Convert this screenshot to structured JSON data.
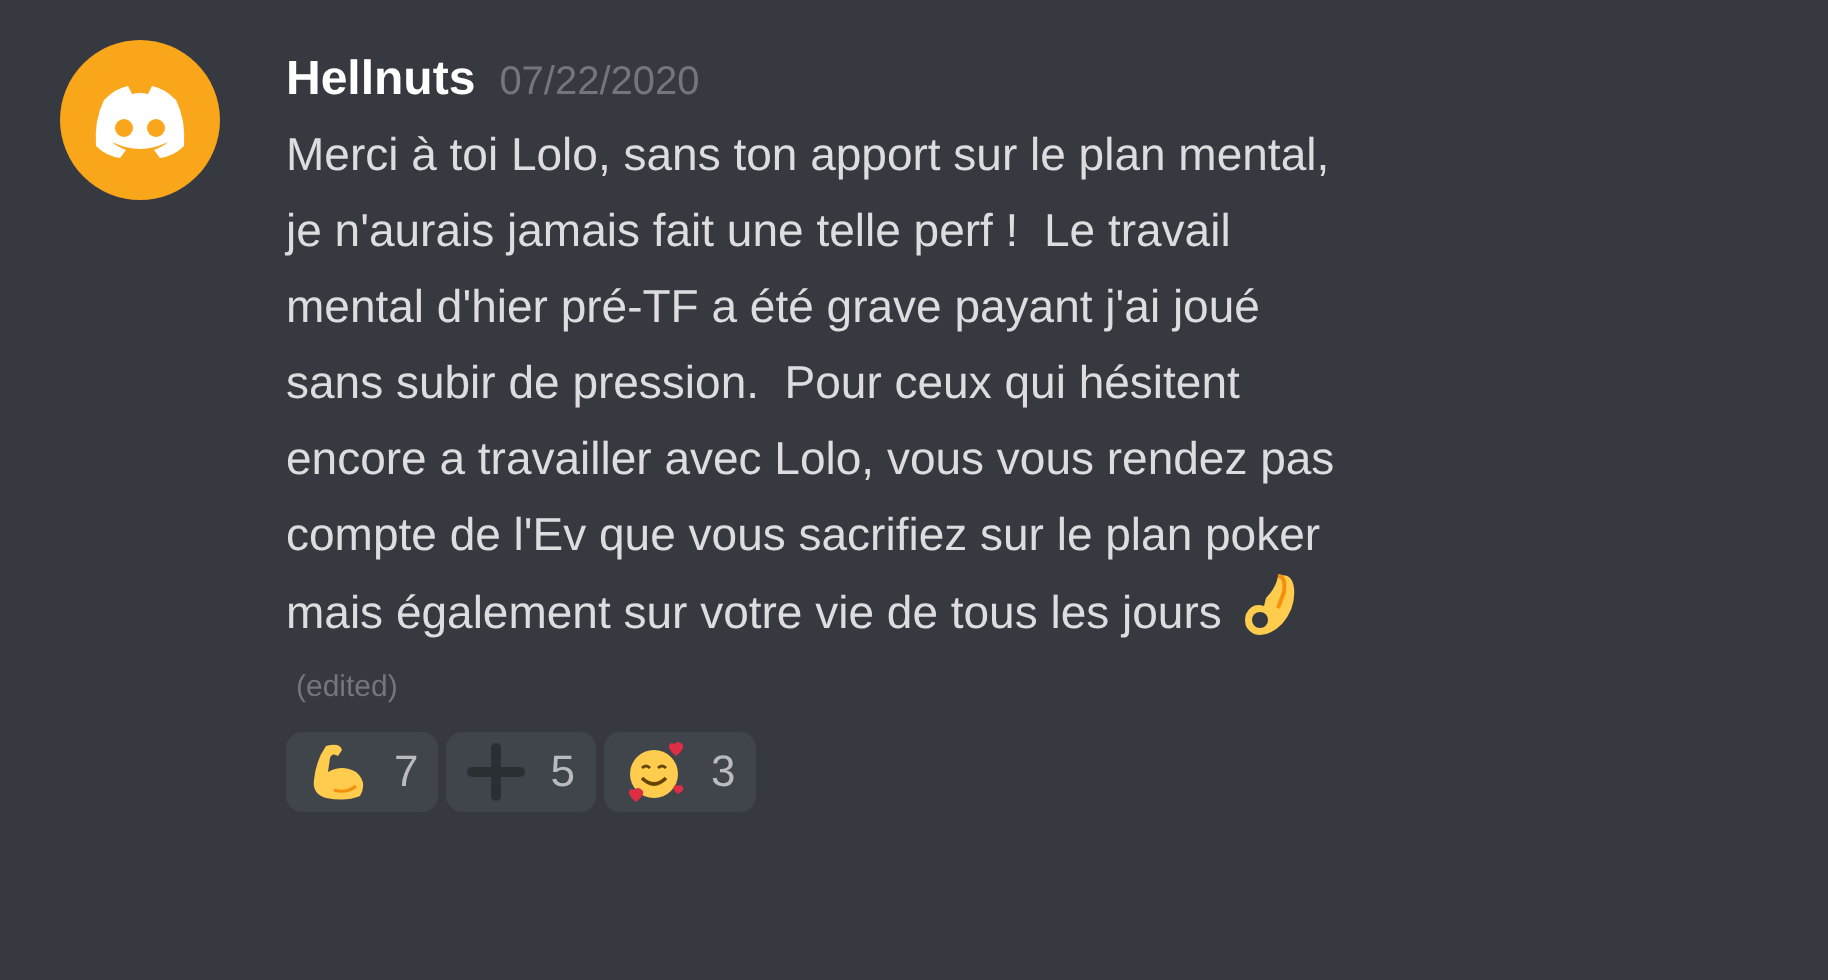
{
  "message": {
    "author": "Hellnuts",
    "timestamp": "07/22/2020",
    "lines": [
      "Merci à toi Lolo, sans ton apport sur le plan mental,",
      "je n'aurais jamais fait une telle perf !  Le travail",
      "mental d'hier pré-TF a été grave payant j'ai joué",
      "sans subir de pression.  Pour ceux qui hésitent",
      "encore a travailler avec Lolo, vous vous rendez pas",
      "compte de l'Ev que vous sacrifiez sur le plan poker",
      "mais également sur votre vie de tous les jours"
    ],
    "edited": "(edited)"
  },
  "reactions": [
    {
      "kind": "muscle",
      "count": "7"
    },
    {
      "kind": "plus",
      "count": "5"
    },
    {
      "kind": "hearts",
      "count": "3"
    }
  ]
}
